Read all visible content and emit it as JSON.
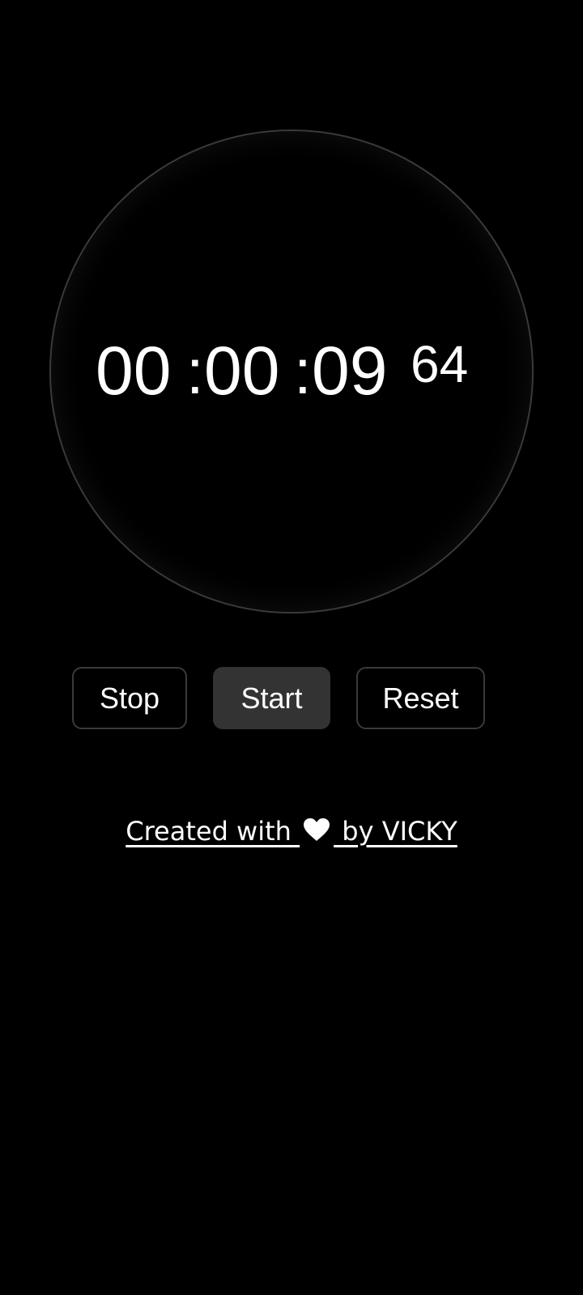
{
  "timer": {
    "hours": "00",
    "sep1": ":",
    "minutes": "00",
    "sep2": ":",
    "seconds": "09",
    "centiseconds": "64"
  },
  "controls": {
    "stop_label": "Stop",
    "start_label": "Start",
    "reset_label": "Reset",
    "active": "start"
  },
  "footer": {
    "prefix": "Created with ",
    "icon": "heart-icon",
    "suffix": " by VICKY"
  },
  "colors": {
    "background": "#000000",
    "text": "#ffffff",
    "active_button": "#333333",
    "border": "#3a3a3a"
  }
}
